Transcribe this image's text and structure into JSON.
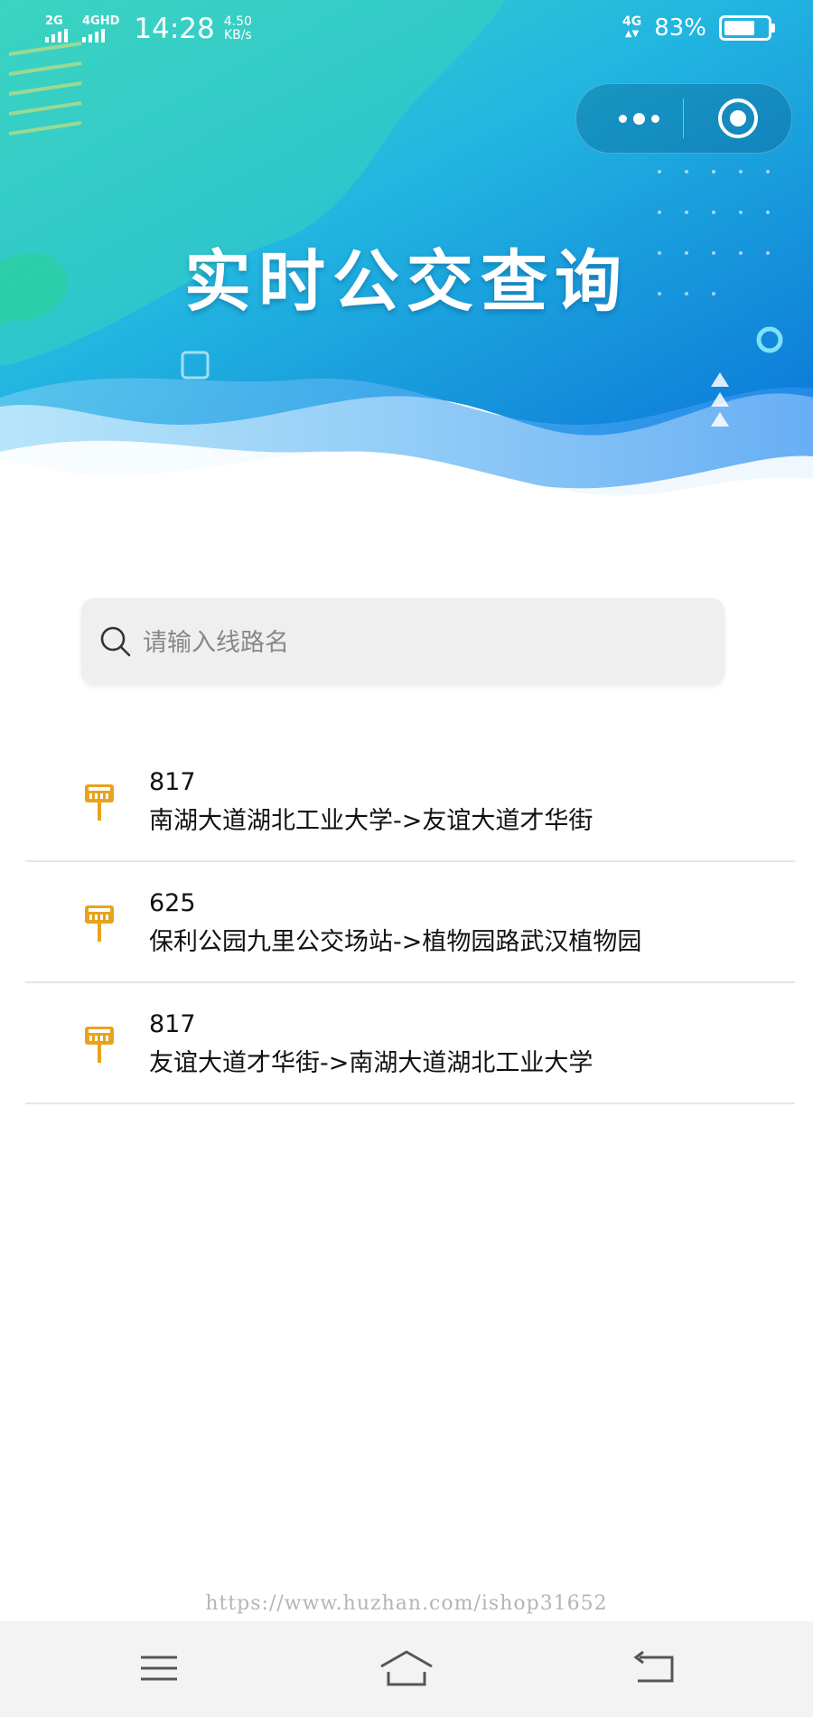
{
  "status_bar": {
    "signal1_label": "2G",
    "signal2_label": "4GHD",
    "time": "14:28",
    "speed_value": "4.50",
    "speed_unit": "KB/s",
    "network": "4G",
    "battery_percent": "83%",
    "battery_level": 0.83
  },
  "capsule": {
    "menu_icon": "more-dots-icon",
    "close_icon": "target-close-icon"
  },
  "header": {
    "title": "实时公交查询",
    "colors": {
      "teal": "#35d0c6",
      "blue": "#1f9be8",
      "deep_blue": "#0c78d8"
    }
  },
  "search": {
    "placeholder": "请输入线路名",
    "value": "",
    "icon": "search-icon"
  },
  "routes": [
    {
      "number": "817",
      "path": "南湖大道湖北工业大学->友谊大道才华街",
      "icon": "bus-stop-sign-icon"
    },
    {
      "number": "625",
      "path": "保利公园九里公交场站->植物园路武汉植物园",
      "icon": "bus-stop-sign-icon"
    },
    {
      "number": "817",
      "path": "友谊大道才华街->南湖大道湖北工业大学",
      "icon": "bus-stop-sign-icon"
    }
  ],
  "watermark": "https://www.huzhan.com/ishop31652",
  "nav": {
    "menu_icon": "menu-icon",
    "home_icon": "home-icon",
    "back_icon": "back-icon",
    "accent_icon_color": "#e8a31c"
  }
}
